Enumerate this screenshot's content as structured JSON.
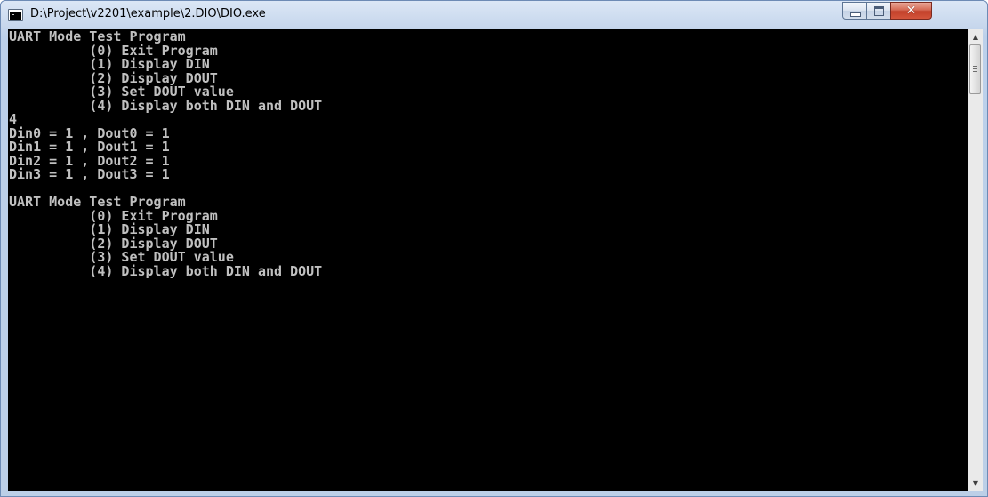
{
  "window": {
    "title": "D:\\Project\\v2201\\example\\2.DIO\\DIO.exe"
  },
  "caption_buttons": {
    "close_glyph": "✕"
  },
  "console": {
    "lines": [
      "UART Mode Test Program",
      "          (0) Exit Program",
      "          (1) Display DIN",
      "          (2) Display DOUT",
      "          (3) Set DOUT value",
      "          (4) Display both DIN and DOUT",
      "4",
      "Din0 = 1 , Dout0 = 1",
      "Din1 = 1 , Dout1 = 1",
      "Din2 = 1 , Dout2 = 1",
      "Din3 = 1 , Dout3 = 1",
      "",
      "UART Mode Test Program",
      "          (0) Exit Program",
      "          (1) Display DIN",
      "          (2) Display DOUT",
      "          (3) Set DOUT value",
      "          (4) Display both DIN and DOUT"
    ]
  },
  "scrollbar": {
    "up_arrow": "▲",
    "down_arrow": "▼"
  },
  "colors": {
    "console_bg": "#000000",
    "console_fg": "#c0c0c0",
    "close_button": "#c2412a"
  },
  "icons": {
    "app": "console-app-icon",
    "minimize": "minimize-icon",
    "maximize": "maximize-icon",
    "close": "close-icon"
  }
}
